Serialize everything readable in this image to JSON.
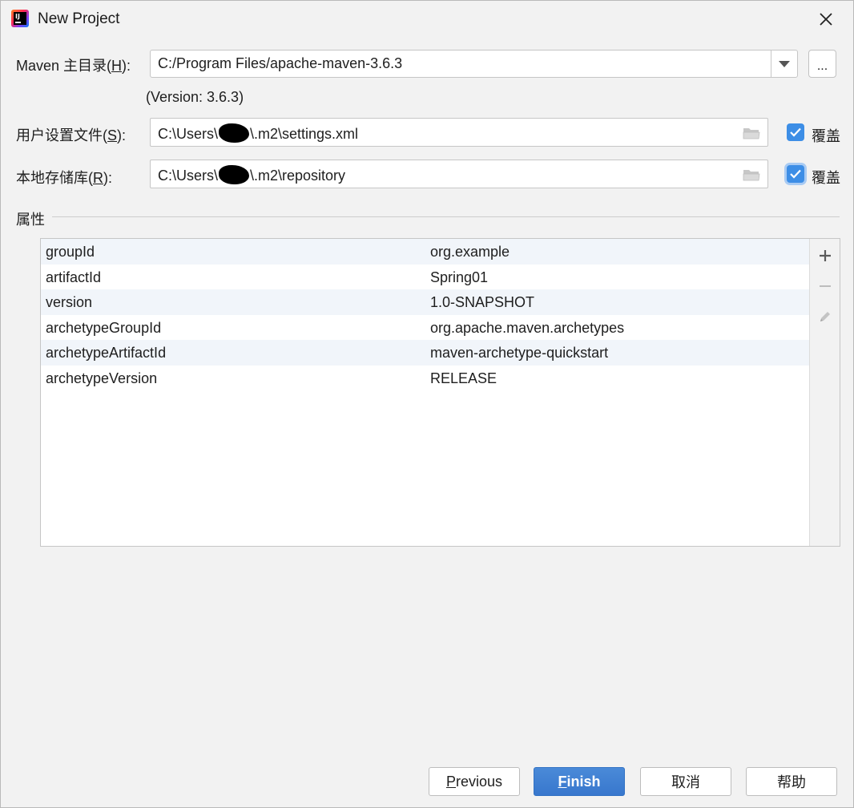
{
  "window": {
    "title": "New Project"
  },
  "maven_home": {
    "label_prefix": "Maven 主目录(",
    "label_mnemonic": "H",
    "label_suffix": "):",
    "value": "C:/Program Files/apache-maven-3.6.3",
    "browse_label": "...",
    "version_note": "(Version: 3.6.3)"
  },
  "settings_file": {
    "label_prefix": "用户设置文件(",
    "label_mnemonic": "S",
    "label_suffix": "):",
    "value_before": "C:\\Users\\",
    "value_after": "\\.m2\\settings.xml",
    "override_label": "覆盖",
    "override_checked": true
  },
  "local_repo": {
    "label_prefix": "本地存储库(",
    "label_mnemonic": "R",
    "label_suffix": "):",
    "value_before": "C:\\Users\\",
    "value_after": "\\.m2\\repository",
    "override_label": "覆盖",
    "override_checked": true
  },
  "properties": {
    "title": "属性",
    "rows": [
      {
        "key": "groupId",
        "value": "org.example"
      },
      {
        "key": "artifactId",
        "value": "Spring01"
      },
      {
        "key": "version",
        "value": "1.0-SNAPSHOT"
      },
      {
        "key": "archetypeGroupId",
        "value": "org.apache.maven.archetypes"
      },
      {
        "key": "archetypeArtifactId",
        "value": "maven-archetype-quickstart"
      },
      {
        "key": "archetypeVersion",
        "value": "RELEASE"
      }
    ],
    "toolbar": [
      "add-icon",
      "remove-icon",
      "edit-icon"
    ]
  },
  "buttons": {
    "previous_mnemonic": "P",
    "previous_rest": "revious",
    "finish_mnemonic": "F",
    "finish_rest": "inish",
    "cancel": "取消",
    "help": "帮助"
  },
  "colors": {
    "accent": "#3d8ee6",
    "primary_button": "#3d7fd1",
    "row_alt": "#f1f5fa"
  }
}
